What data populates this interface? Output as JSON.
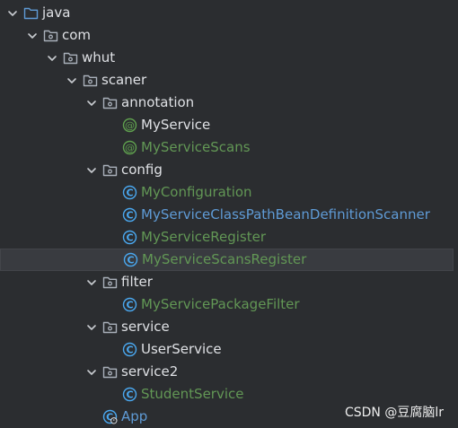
{
  "theme": {
    "background": "#2b2d30",
    "selection": "#393b40",
    "text_default": "#dfe1e5",
    "text_green": "#629755",
    "text_blue": "#5f9bd6",
    "folder_icon_color": "#a9b0ba",
    "annotation_icon_color": "#5fa04e",
    "class_icon_color": "#4aa8f0"
  },
  "tree": [
    {
      "label": "java",
      "depth": 0,
      "icon": "source-folder-icon",
      "expanded": true,
      "color": "default"
    },
    {
      "label": "com",
      "depth": 1,
      "icon": "package-icon",
      "expanded": true,
      "color": "default"
    },
    {
      "label": "whut",
      "depth": 2,
      "icon": "package-icon",
      "expanded": true,
      "color": "default"
    },
    {
      "label": "scaner",
      "depth": 3,
      "icon": "package-icon",
      "expanded": true,
      "color": "default"
    },
    {
      "label": "annotation",
      "depth": 4,
      "icon": "package-icon",
      "expanded": true,
      "color": "default"
    },
    {
      "label": "MyService",
      "depth": 5,
      "icon": "annotation-icon",
      "expanded": null,
      "color": "default"
    },
    {
      "label": "MyServiceScans",
      "depth": 5,
      "icon": "annotation-icon",
      "expanded": null,
      "color": "green"
    },
    {
      "label": "config",
      "depth": 4,
      "icon": "package-icon",
      "expanded": true,
      "color": "default"
    },
    {
      "label": "MyConfiguration",
      "depth": 5,
      "icon": "class-icon",
      "expanded": null,
      "color": "green"
    },
    {
      "label": "MyServiceClassPathBeanDefinitionScanner",
      "depth": 5,
      "icon": "class-icon",
      "expanded": null,
      "color": "blue"
    },
    {
      "label": "MyServiceRegister",
      "depth": 5,
      "icon": "class-icon",
      "expanded": null,
      "color": "green"
    },
    {
      "label": "MyServiceScansRegister",
      "depth": 5,
      "icon": "class-icon",
      "expanded": null,
      "color": "green",
      "selected": true
    },
    {
      "label": "filter",
      "depth": 4,
      "icon": "package-icon",
      "expanded": true,
      "color": "default"
    },
    {
      "label": "MyServicePackageFilter",
      "depth": 5,
      "icon": "class-icon",
      "expanded": null,
      "color": "green"
    },
    {
      "label": "service",
      "depth": 4,
      "icon": "package-icon",
      "expanded": true,
      "color": "default"
    },
    {
      "label": "UserService",
      "depth": 5,
      "icon": "class-icon",
      "expanded": null,
      "color": "default"
    },
    {
      "label": "service2",
      "depth": 4,
      "icon": "package-icon",
      "expanded": true,
      "color": "default"
    },
    {
      "label": "StudentService",
      "depth": 5,
      "icon": "class-icon",
      "expanded": null,
      "color": "green"
    },
    {
      "label": "App",
      "depth": 4,
      "icon": "main-class-icon",
      "expanded": null,
      "color": "blue"
    }
  ],
  "watermark": "CSDN @豆腐脑lr"
}
